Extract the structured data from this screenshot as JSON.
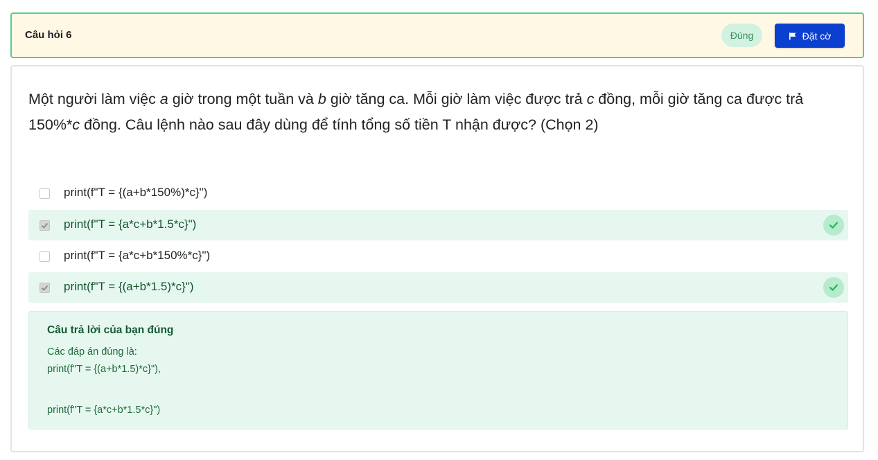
{
  "header": {
    "title": "Câu hỏi 6",
    "status": "Đúng",
    "flag_label": "Đặt cờ"
  },
  "question": {
    "p1": "Một người làm việc ",
    "v_a": "a",
    "p2": " giờ trong một tuần và ",
    "v_b": "b",
    "p3": " giờ tăng ca. Mỗi giờ làm việc được trả ",
    "v_c1": "c",
    "p4": " đồng, mỗi giờ tăng ca được trả 150%*",
    "v_c2": "c",
    "p5": " đồng. Câu lệnh nào sau đây dùng để tính tổng số tiền T nhận được? (Chọn 2)"
  },
  "options": [
    {
      "text": "print(f\"T = {(a+b*150%)*c}\")",
      "checked": false,
      "correct": false
    },
    {
      "text": "print(f\"T = {a*c+b*1.5*c}\")",
      "checked": true,
      "correct": true
    },
    {
      "text": "print(f\"T = {a*c+b*150%*c}\")",
      "checked": false,
      "correct": false
    },
    {
      "text": "print(f\"T = {(a+b*1.5)*c}\")",
      "checked": true,
      "correct": true
    }
  ],
  "feedback": {
    "title": "Câu trả lời của bạn đúng",
    "intro": "Các đáp án đúng là:",
    "answer1": "print(f\"T = {(a+b*1.5)*c}\"),",
    "answer2": "print(f\"T = {a*c+b*1.5*c}\")"
  },
  "colors": {
    "header_bg": "#fff8e5",
    "header_border": "#5ccb8a",
    "flag_button": "#0b3fcf",
    "correct_bg": "#e6f7ef",
    "correct_check": "#2fb56a"
  },
  "icons": {
    "flag": "flag-icon",
    "check": "check-icon"
  }
}
